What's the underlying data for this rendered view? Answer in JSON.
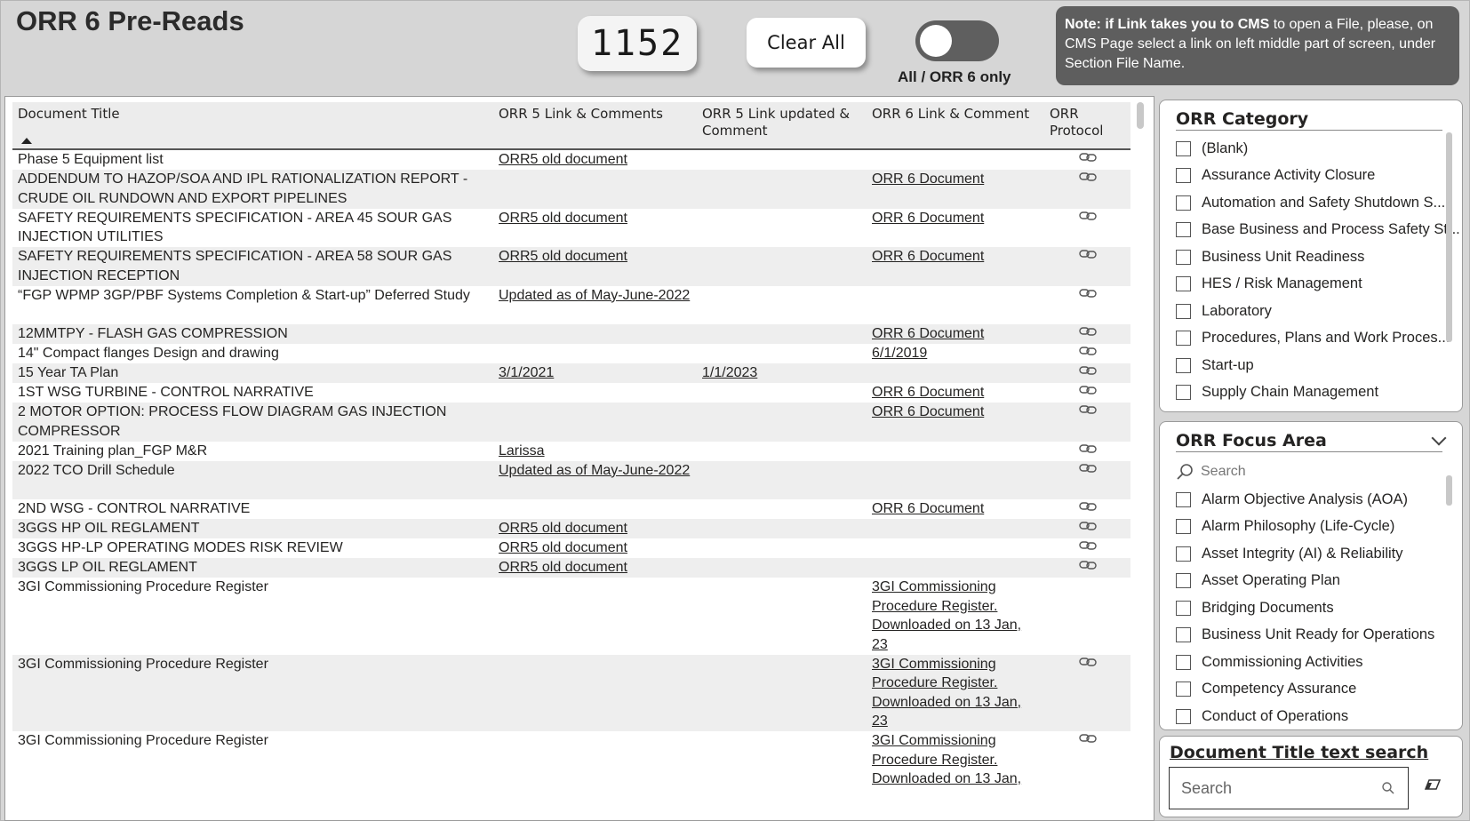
{
  "header": {
    "title": "ORR 6 Pre-Reads",
    "count": "1152",
    "clear_label": "Clear All",
    "toggle_label": "All / ORR 6 only",
    "note_bold": "Note: if Link takes you to CMS",
    "note_rest": " to open a File, please, on CMS Page select a link on left middle part of screen, under Section File Name."
  },
  "table": {
    "columns": [
      "Document Title",
      "ORR 5 Link & Comments",
      "ORR 5 Link updated & Comment",
      "ORR 6 Link & Comment",
      "ORR Protocol"
    ],
    "rows": [
      {
        "title": "Phase 5 Equipment list",
        "orr5": "ORR5 old document",
        "orr5u": "",
        "orr6": "",
        "h": 1
      },
      {
        "title": "ADDENDUM TO HAZOP/SOA AND IPL RATIONALIZATION REPORT - CRUDE OIL RUNDOWN AND EXPORT PIPELINES",
        "orr5": "",
        "orr5u": "",
        "orr6": "ORR 6 Document",
        "h": 2
      },
      {
        "title": "SAFETY REQUIREMENTS SPECIFICATION - AREA 45 SOUR GAS INJECTION UTILITIES",
        "orr5": "ORR5 old document",
        "orr5u": "",
        "orr6": "ORR 6 Document",
        "h": 2
      },
      {
        "title": "SAFETY REQUIREMENTS SPECIFICATION - AREA 58 SOUR GAS INJECTION RECEPTION",
        "orr5": "ORR5 old document",
        "orr5u": "",
        "orr6": "ORR 6 Document",
        "h": 2
      },
      {
        "title": "“FGP WPMP 3GP/PBF Systems Completion & Start-up” Deferred Study",
        "orr5": "Updated as of May-June-2022",
        "orr5u": "",
        "orr6": "",
        "h": 2
      },
      {
        "title": "12MMTPY - FLASH GAS COMPRESSION",
        "orr5": "",
        "orr5u": "",
        "orr6": "ORR 6 Document",
        "h": 1
      },
      {
        "title": "14\" Compact flanges Design and drawing",
        "orr5": "",
        "orr5u": "",
        "orr6": "6/1/2019",
        "h": 1
      },
      {
        "title": "15 Year TA Plan",
        "orr5": "3/1/2021",
        "orr5u": "1/1/2023",
        "orr6": "",
        "h": 1
      },
      {
        "title": "1ST WSG TURBINE - CONTROL NARRATIVE",
        "orr5": "",
        "orr5u": "",
        "orr6": "ORR 6 Document",
        "h": 1
      },
      {
        "title": "2 MOTOR OPTION: PROCESS FLOW DIAGRAM GAS INJECTION COMPRESSOR",
        "orr5": "",
        "orr5u": "",
        "orr6": "ORR 6 Document",
        "h": 2
      },
      {
        "title": "2021 Training plan_FGP M&R",
        "orr5": "Larissa",
        "orr5u": "",
        "orr6": "",
        "h": 1
      },
      {
        "title": "2022 TCO Drill Schedule",
        "orr5": "Updated as of May-June-2022",
        "orr5u": "",
        "orr6": "",
        "h": 2
      },
      {
        "title": "2ND WSG - CONTROL NARRATIVE",
        "orr5": "",
        "orr5u": "",
        "orr6": "ORR 6 Document",
        "h": 1
      },
      {
        "title": "3GGS HP OIL REGLAMENT",
        "orr5": "ORR5 old document",
        "orr5u": "",
        "orr6": "",
        "h": 1
      },
      {
        "title": "3GGS HP-LP OPERATING MODES RISK REVIEW",
        "orr5": "ORR5 old document",
        "orr5u": "",
        "orr6": "",
        "h": 1
      },
      {
        "title": "3GGS LP OIL REGLAMENT",
        "orr5": "ORR5 old document",
        "orr5u": "",
        "orr6": "",
        "h": 1
      },
      {
        "title": "3GI Commissioning Procedure Register",
        "orr5": "",
        "orr5u": "",
        "orr6": "3GI Commissioning Procedure Register. Downloaded on 13 Jan, 23",
        "h": 4,
        "noicon": true
      },
      {
        "title": "3GI Commissioning Procedure Register",
        "orr5": "",
        "orr5u": "",
        "orr6": "3GI Commissioning Procedure Register. Downloaded on 13 Jan, 23",
        "h": 4
      },
      {
        "title": "3GI Commissioning Procedure Register",
        "orr5": "",
        "orr5u": "",
        "orr6": "3GI Commissioning Procedure Register. Downloaded on 13 Jan,",
        "h": 3
      }
    ]
  },
  "orr_category": {
    "title": "ORR Category",
    "options": [
      "(Blank)",
      "Assurance Activity Closure",
      "Automation and Safety Shutdown S...",
      "Base Business and Process Safety St...",
      "Business Unit Readiness",
      "HES / Risk Management",
      "Laboratory",
      "Procedures, Plans and Work Proces...",
      "Start-up",
      "Supply Chain Management"
    ]
  },
  "orr_focus": {
    "title": "ORR Focus Area",
    "search_placeholder": "Search",
    "options": [
      "Alarm Objective Analysis (AOA)",
      "Alarm Philosophy (Life-Cycle)",
      "Asset Integrity (AI) & Reliability",
      "Asset Operating Plan",
      "Bridging Documents",
      "Business Unit Ready for Operations",
      "Commissioning Activities",
      "Competency Assurance",
      "Conduct of Operations"
    ]
  },
  "doc_search": {
    "title": "Document Title text search",
    "placeholder": "Search"
  }
}
